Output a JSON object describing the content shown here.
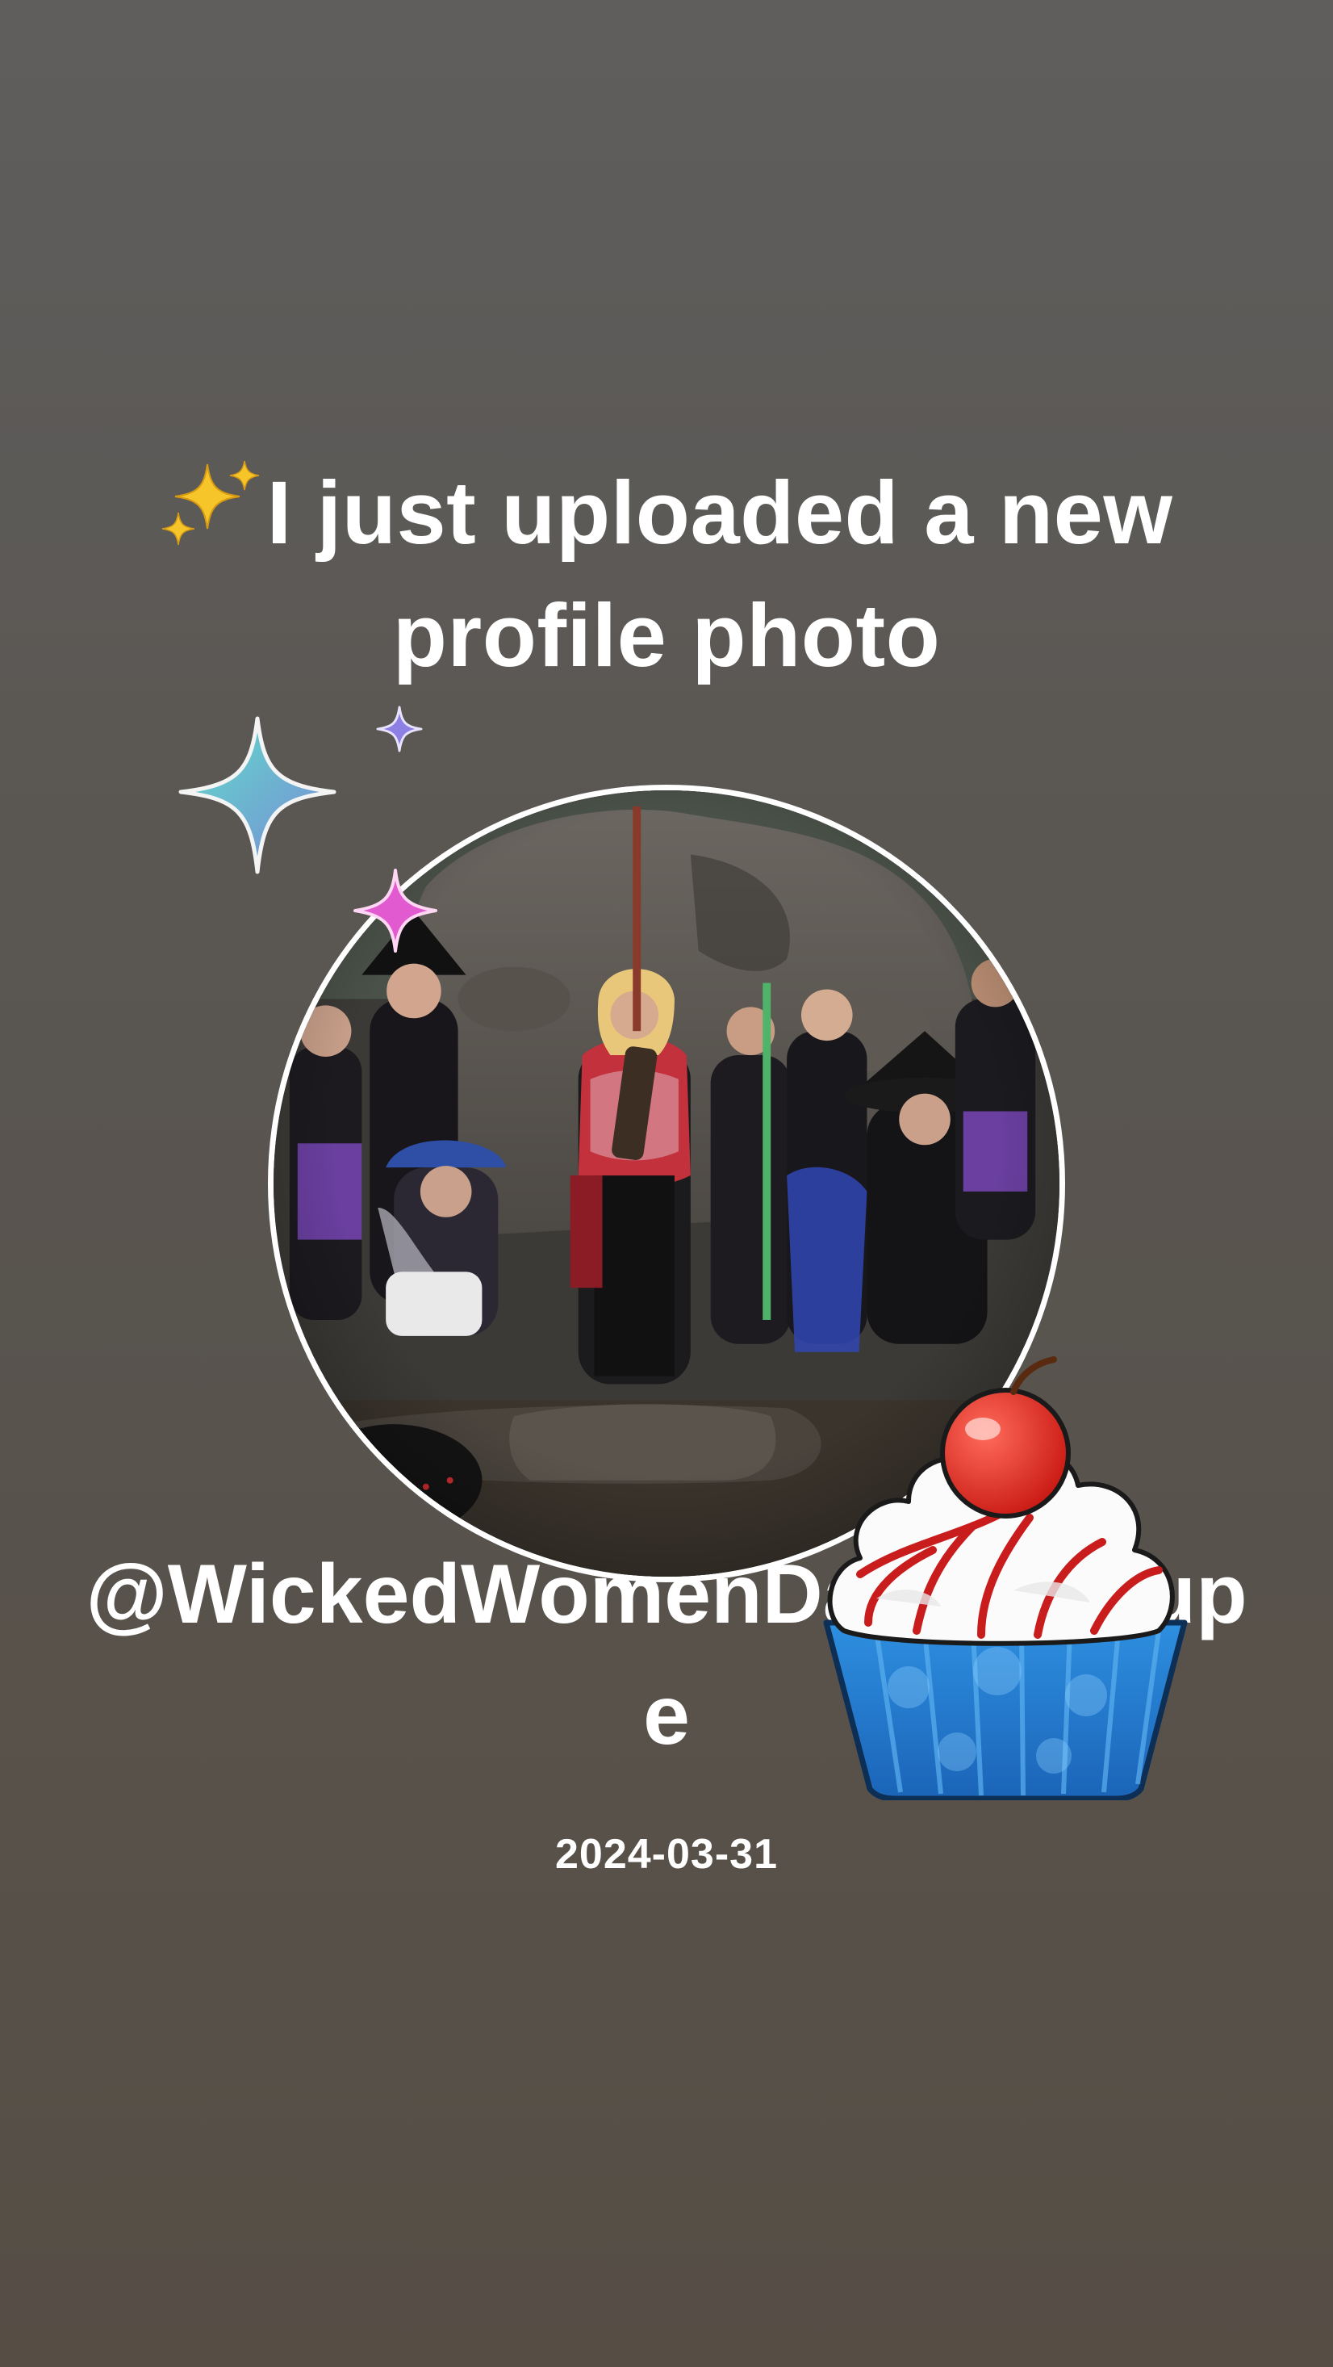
{
  "headline": {
    "emoji": "sparkles-icon",
    "text": "I just uploaded a new profile photo"
  },
  "profile": {
    "handle": "@WickedWomenDanceTroupe",
    "date": "2024-03-31",
    "photo_subject": "group-photo"
  },
  "stickers": {
    "cupcake": "cupcake-sticker",
    "sparkles": [
      "sparkle-teal",
      "sparkle-purple",
      "sparkle-pink"
    ]
  },
  "colors": {
    "background_top": "#5f5e5d",
    "background_bottom": "#564e45",
    "text": "#ffffff",
    "ring": "#ffffff"
  }
}
